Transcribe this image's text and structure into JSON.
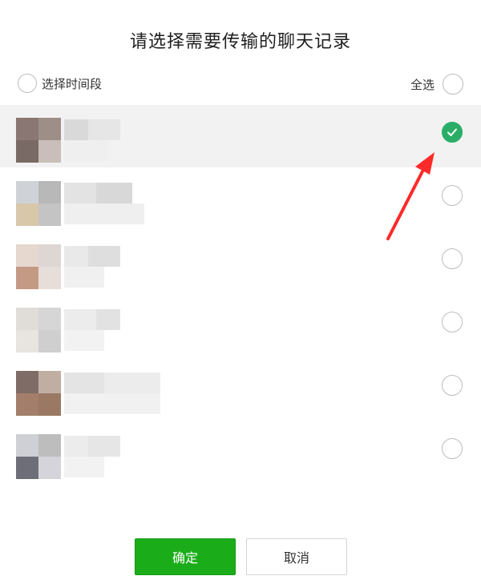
{
  "dialog": {
    "title": "请选择需要传输的聊天记录",
    "range_select_label": "选择时间段",
    "select_all_label": "全选",
    "confirm_label": "确定",
    "cancel_label": "取消"
  },
  "colors": {
    "accent_green": "#1aad19",
    "check_green": "#2aae67",
    "selected_row_bg": "#f2f2f2",
    "annotation_arrow": "#ff2a2a"
  },
  "chat_list": {
    "rows": [
      {
        "selected": true
      },
      {
        "selected": false
      },
      {
        "selected": false
      },
      {
        "selected": false
      },
      {
        "selected": false
      },
      {
        "selected": false
      }
    ]
  },
  "icons": {
    "check": "check-icon",
    "radio": "radio-empty-icon",
    "arrow": "annotation-arrow-icon"
  }
}
